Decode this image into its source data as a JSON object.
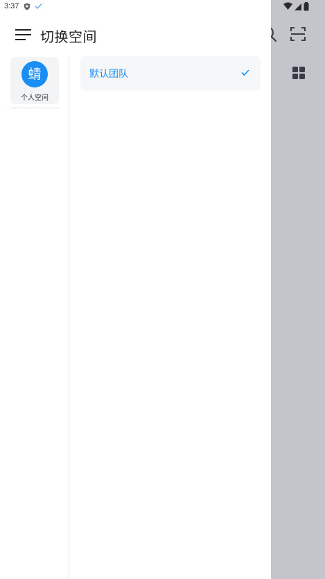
{
  "status_bar": {
    "time": "3:37"
  },
  "header": {
    "title": "切换空间"
  },
  "spaces": [
    {
      "avatar_char": "蜻",
      "label": "个人空间",
      "selected": true
    }
  ],
  "teams": [
    {
      "label": "默认团队",
      "selected": true
    }
  ],
  "colors": {
    "accent": "#1b8ef5",
    "scrim": "#c4c5ca",
    "card_bg": "#f3f4f6"
  },
  "icons": {
    "menu": "menu-icon",
    "check": "check-icon",
    "search": "search-icon",
    "scan": "scan-icon",
    "grid": "grid-icon"
  }
}
